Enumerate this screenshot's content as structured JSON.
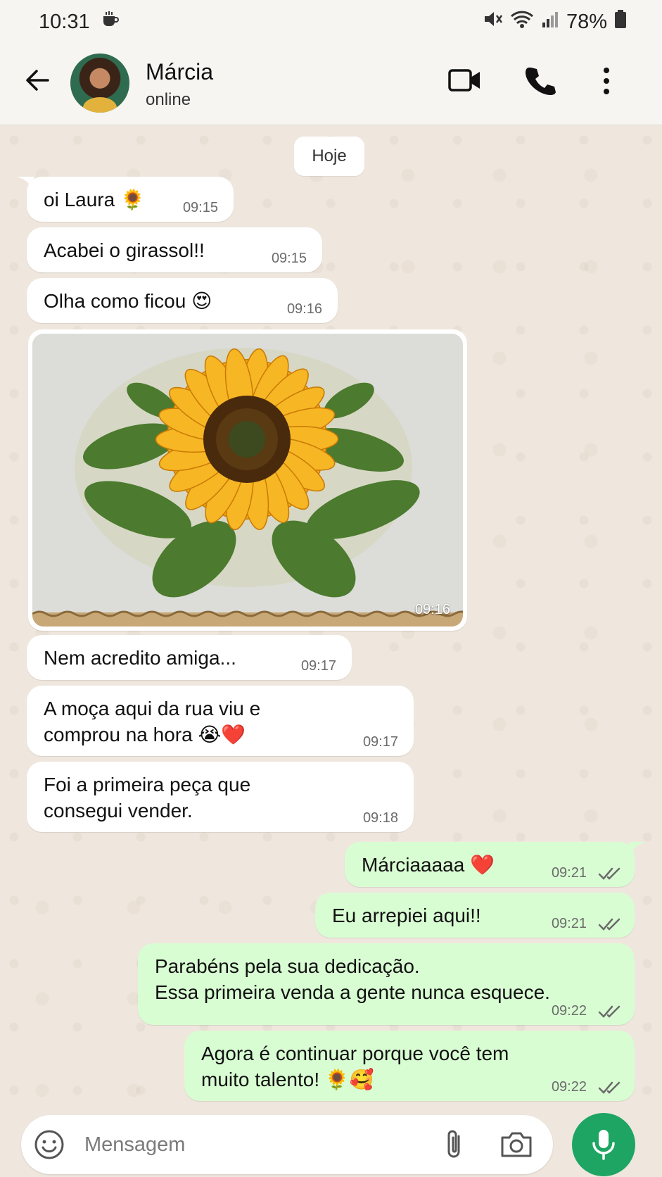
{
  "status_bar": {
    "time": "10:31",
    "battery": "78%"
  },
  "header": {
    "name": "Márcia",
    "status": "online"
  },
  "chat": {
    "date_chip": "Hoje",
    "incoming": [
      {
        "text": "oi Laura 🌻",
        "time": "09:15"
      },
      {
        "text": "Acabei o girassol!!",
        "time": "09:15"
      },
      {
        "text": "Olha como ficou 😍",
        "time": "09:16"
      },
      {
        "text": "Nem acredito amiga...",
        "time": "09:17"
      },
      {
        "text_line1": "A moça aqui da rua viu e",
        "text_line2": "comprou na hora 😭❤️",
        "time": "09:17"
      },
      {
        "text_line1": "Foi a primeira peça que",
        "text_line2": "consegui vender.",
        "time": "09:18"
      }
    ],
    "image": {
      "time": "09:16"
    },
    "outgoing": [
      {
        "text": "Márciaaaaa ❤️",
        "time": "09:21"
      },
      {
        "text": "Eu arrepiei aqui!!",
        "time": "09:21"
      },
      {
        "text_line1": "Parabéns pela sua dedicação.",
        "text_line2": "Essa primeira venda a gente nunca esquece.",
        "time": "09:22"
      },
      {
        "text_line1": "Agora é continuar porque você tem",
        "text_line2": "muito talento! 🌻🥰",
        "time": "09:22"
      }
    ]
  },
  "input": {
    "placeholder": "Mensagem"
  },
  "colors": {
    "outgoing_bubble": "#d9fdd3",
    "incoming_bubble": "#ffffff",
    "mic_button": "#1ea563",
    "chat_background": "#efe7de",
    "read_ticks": "#6b6b6b"
  }
}
